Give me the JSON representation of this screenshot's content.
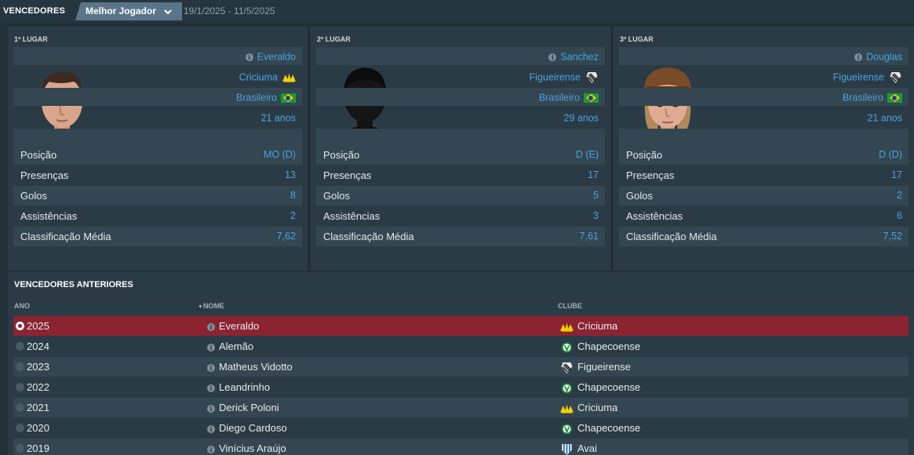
{
  "header": {
    "title": "VENCEDORES",
    "dropdown_value": "Melhor Jogador",
    "date_range": "19/1/2025 - 11/5/2025"
  },
  "podium": [
    {
      "place": "1º LUGAR",
      "name": "Everaldo",
      "club": "Criciuma",
      "nationality": "Brasileiro",
      "age": "21 anos",
      "stats": [
        {
          "label": "Posição",
          "value": "MO (D)"
        },
        {
          "label": "Presenças",
          "value": "13"
        },
        {
          "label": "Golos",
          "value": "8"
        },
        {
          "label": "Assistências",
          "value": "2"
        },
        {
          "label": "Classificação Média",
          "value": "7,62"
        }
      ]
    },
    {
      "place": "2º LUGAR",
      "name": "Sanchez",
      "club": "Figueirense",
      "nationality": "Brasileiro",
      "age": "29 anos",
      "stats": [
        {
          "label": "Posição",
          "value": "D (E)"
        },
        {
          "label": "Presenças",
          "value": "17"
        },
        {
          "label": "Golos",
          "value": "5"
        },
        {
          "label": "Assistências",
          "value": "3"
        },
        {
          "label": "Classificação Média",
          "value": "7,61"
        }
      ]
    },
    {
      "place": "3º LUGAR",
      "name": "Douglas",
      "club": "Figueirense",
      "nationality": "Brasileiro",
      "age": "21 anos",
      "stats": [
        {
          "label": "Posição",
          "value": "D (D)"
        },
        {
          "label": "Presenças",
          "value": "17"
        },
        {
          "label": "Golos",
          "value": "2"
        },
        {
          "label": "Assistências",
          "value": "6"
        },
        {
          "label": "Classificação Média",
          "value": "7,52"
        }
      ]
    }
  ],
  "previous_winners": {
    "title": "VENCEDORES ANTERIORES",
    "columns": {
      "year": "ANO",
      "name": "NOME",
      "club": "CLUBE"
    },
    "rows": [
      {
        "year": "2025",
        "name": "Everaldo",
        "club": "Criciuma"
      },
      {
        "year": "2024",
        "name": "Alemão",
        "club": "Chapecoense"
      },
      {
        "year": "2023",
        "name": "Matheus Vidotto",
        "club": "Figueirense"
      },
      {
        "year": "2022",
        "name": "Leandrinho",
        "club": "Chapecoense"
      },
      {
        "year": "2021",
        "name": "Derick Poloni",
        "club": "Criciuma"
      },
      {
        "year": "2020",
        "name": "Diego Cardoso",
        "club": "Chapecoense"
      },
      {
        "year": "2019",
        "name": "Vinícius Araújo",
        "club": "Avai"
      }
    ]
  },
  "colors": {
    "accent": "#4aa3e0",
    "selected_row": "#8b2330",
    "panel": "#2b3b46"
  }
}
